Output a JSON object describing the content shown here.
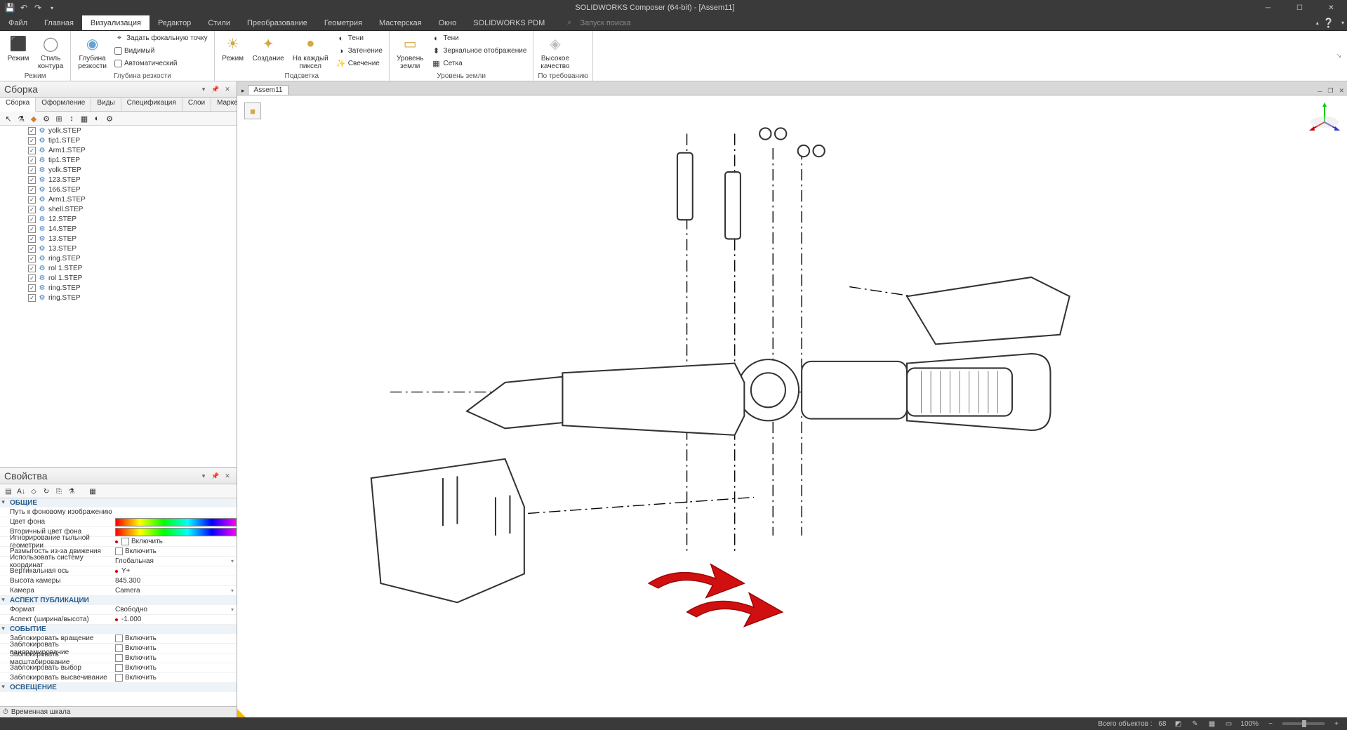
{
  "title": "SOLIDWORKS Composer (64-bit) - [Assem11]",
  "menus": [
    "Файл",
    "Главная",
    "Визуализация",
    "Редактор",
    "Стили",
    "Преобразование",
    "Геометрия",
    "Мастерская",
    "Окно",
    "SOLIDWORKS PDM"
  ],
  "active_menu": 2,
  "search_hint": "Запуск поиска",
  "ribbon": {
    "groups": [
      {
        "label": "Режим",
        "items": [
          {
            "big": true,
            "label": "Режим",
            "icon": "◧"
          },
          {
            "big": true,
            "label": "Стиль\nконтура",
            "icon": "◯"
          }
        ]
      },
      {
        "label": "Глубина резкости",
        "items": [
          {
            "big": true,
            "label": "Глубина\nрезкости",
            "icon": "◉"
          },
          {
            "col": [
              {
                "label": "Задать фокальную точку",
                "icon": "⌖"
              },
              {
                "label": "Видимый",
                "check": true
              },
              {
                "label": "Автоматический",
                "check": true
              }
            ]
          }
        ]
      },
      {
        "label": "Подсветка",
        "items": [
          {
            "big": true,
            "label": "Режим",
            "icon": "☀"
          },
          {
            "big": true,
            "label": "Создание",
            "icon": "✦"
          },
          {
            "big": true,
            "label": "На каждый\nпиксел",
            "icon": "●"
          },
          {
            "col": [
              {
                "label": "Тени",
                "icon": "◐"
              },
              {
                "label": "Затенение",
                "icon": "◑"
              },
              {
                "label": "Свечение",
                "icon": "✨"
              }
            ]
          }
        ]
      },
      {
        "label": "Уровень земли",
        "items": [
          {
            "big": true,
            "label": "Уровень\nземли",
            "icon": "▭"
          },
          {
            "col": [
              {
                "label": "Тени",
                "icon": "◐"
              },
              {
                "label": "Зеркальное отображение",
                "icon": "⬍"
              },
              {
                "label": "Сетка",
                "icon": "▦"
              }
            ]
          }
        ]
      },
      {
        "label": "По требованию",
        "items": [
          {
            "big": true,
            "label": "Высокое\nкачество",
            "icon": "◈"
          }
        ]
      }
    ]
  },
  "assembly": {
    "title": "Сборка",
    "tabs": [
      "Сборка",
      "Оформление",
      "Виды",
      "Спецификация",
      "Слои",
      "Маркеры"
    ],
    "active_tab": 0,
    "items": [
      "yolk.STEP",
      "tip1.STEP",
      "Arm1.STEP",
      "tip1.STEP",
      "yolk.STEP",
      "123.STEP",
      "166.STEP",
      "Arm1.STEP",
      "shell.STEP",
      "12.STEP",
      "14.STEP",
      "13.STEP",
      "13.STEP",
      "ring.STEP",
      "rol 1.STEP",
      "rol 1.STEP",
      "ring.STEP",
      "ring.STEP"
    ]
  },
  "properties": {
    "title": "Свойства",
    "sections": [
      {
        "name": "ОБЩИЕ",
        "rows": [
          {
            "n": "Путь к фоновому изображению",
            "v": ""
          },
          {
            "n": "Цвет фона",
            "v": "",
            "grad": true
          },
          {
            "n": "Вторичный цвет фона",
            "v": "",
            "grad": true
          },
          {
            "n": "Игнорирование тыльной геометрии",
            "v": "Включить",
            "dot": true,
            "check": true
          },
          {
            "n": "Размытость из-за движения",
            "v": "Включить",
            "check": true
          },
          {
            "n": "Использовать систему координат",
            "v": "Глобальная",
            "dd": true
          },
          {
            "n": "Вертикальная ось",
            "v": "Y+",
            "dot": true
          },
          {
            "n": "Высота камеры",
            "v": "845.300"
          },
          {
            "n": "Камера",
            "v": "Camera",
            "dd": true
          }
        ]
      },
      {
        "name": "АСПЕКТ ПУБЛИКАЦИИ",
        "rows": [
          {
            "n": "Формат",
            "v": "Свободно",
            "dd": true
          },
          {
            "n": "Аспект (ширина/высота)",
            "v": "-1.000",
            "dot": true
          }
        ]
      },
      {
        "name": "СОБЫТИЕ",
        "rows": [
          {
            "n": "Заблокировать вращение",
            "v": "Включить",
            "check": true
          },
          {
            "n": "Заблокировать панорамирование",
            "v": "Включить",
            "check": true
          },
          {
            "n": "Заблокировать масштабирование",
            "v": "Включить",
            "check": true
          },
          {
            "n": "Заблокировать выбор",
            "v": "Включить",
            "check": true
          },
          {
            "n": "Заблокировать высвечивание",
            "v": "Включить",
            "check": true
          }
        ]
      },
      {
        "name": "ОСВЕЩЕНИЕ",
        "rows": []
      }
    ]
  },
  "timeline_label": "Временная шкала",
  "viewport": {
    "tab": "Assem11"
  },
  "statusbar": {
    "objects_label": "Всего объектов :",
    "objects_count": "68",
    "zoom": "100%"
  }
}
